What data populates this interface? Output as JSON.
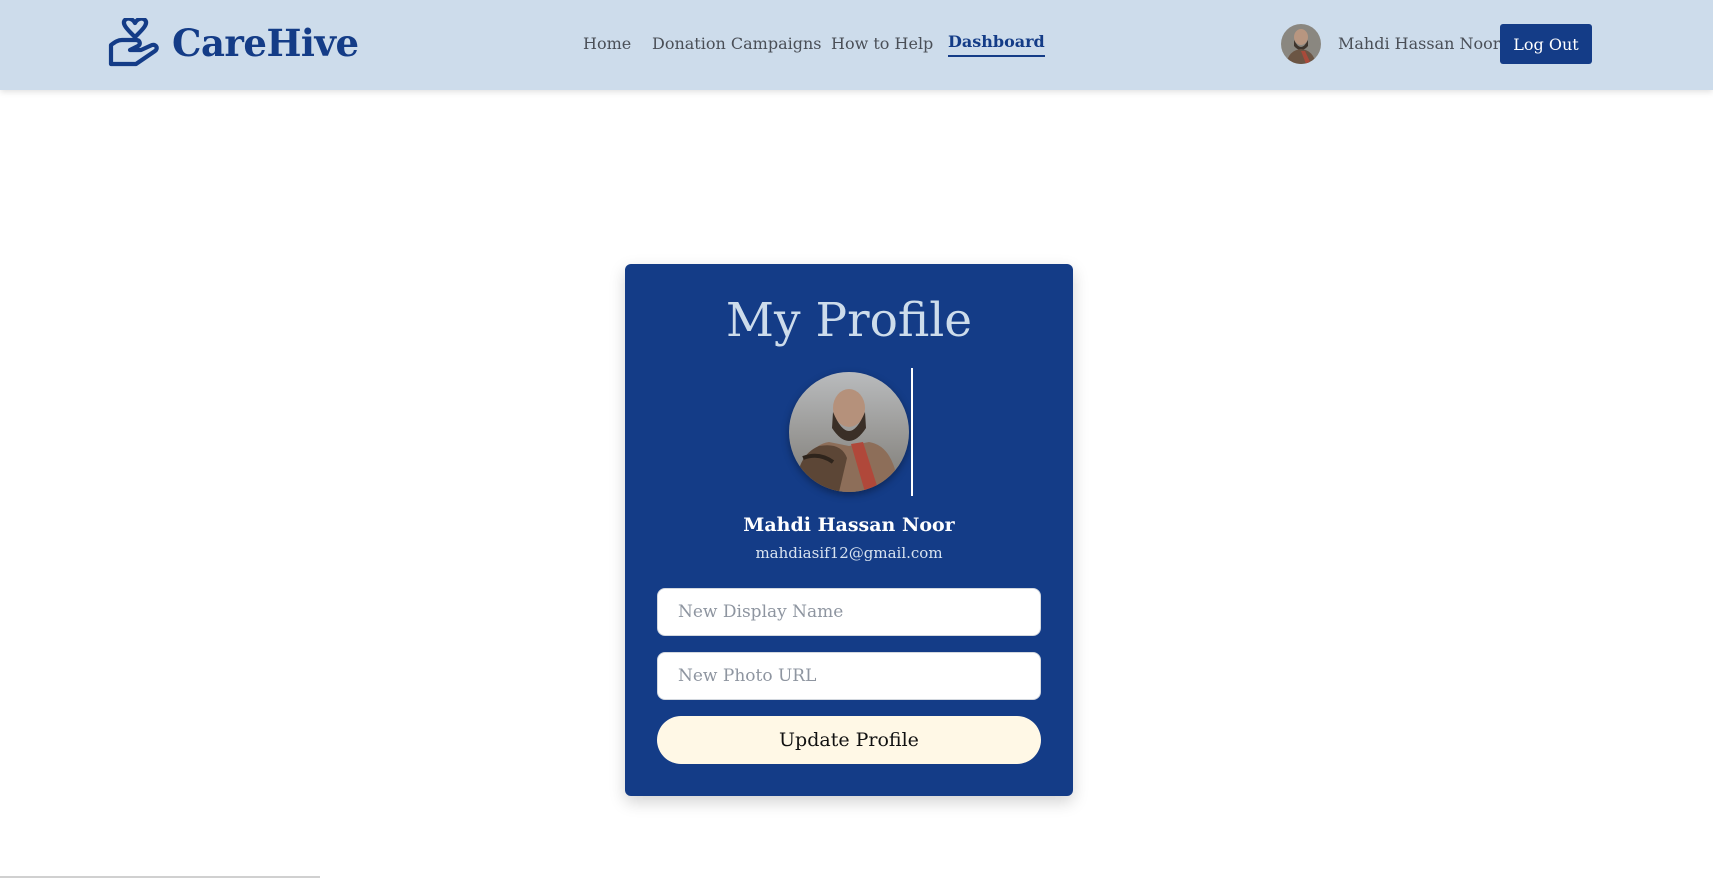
{
  "header": {
    "brand_name": "CareHive",
    "nav": [
      {
        "label": "Home",
        "active": false
      },
      {
        "label": "Donation Campaigns",
        "active": false
      },
      {
        "label": "How to Help",
        "active": false
      },
      {
        "label": "Dashboard",
        "active": true
      }
    ],
    "user_name": "Mahdi Hassan Noor",
    "logout_label": "Log Out"
  },
  "profile": {
    "title": "My Profile",
    "name": "Mahdi Hassan Noor",
    "email": "mahdiasif12@gmail.com",
    "display_name_placeholder": "New Display Name",
    "photo_url_placeholder": "New Photo URL",
    "update_label": "Update Profile"
  },
  "colors": {
    "brand": "#143c87",
    "header_bg": "#cddceb",
    "button_light": "#fff8e6"
  },
  "icons": {
    "brand": "hand-heart-icon",
    "avatar": "user-avatar-photo"
  }
}
